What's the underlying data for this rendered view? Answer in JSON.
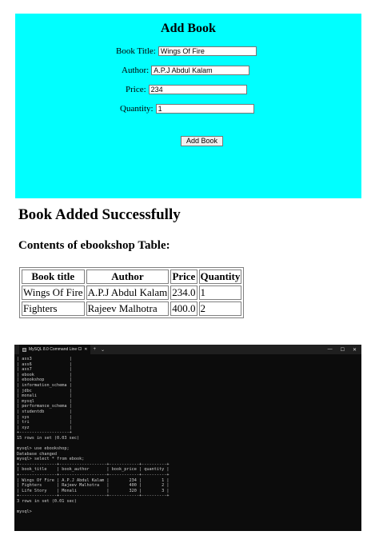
{
  "form": {
    "heading": "Add Book",
    "title_label": "Book Title:",
    "title_value": "Wings Of Fire",
    "author_label": "Author:",
    "author_value": "A.P.J Abdul Kalam",
    "price_label": "Price:",
    "price_value": "234",
    "quantity_label": "Quantity:",
    "quantity_value": "1",
    "submit_label": "Add Book",
    "background": "#00ffff"
  },
  "result": {
    "message": "Book Added Successfully",
    "table_heading": "Contents of ebookshop Table:",
    "columns": [
      "Book title",
      "Author",
      "Price",
      "Quantity"
    ],
    "rows": [
      [
        "Wings Of Fire",
        "A.P.J Abdul Kalam",
        "234.0",
        "1"
      ],
      [
        "Fighters",
        "Rajeev Malhotra",
        "400.0",
        "2"
      ]
    ]
  },
  "terminal": {
    "tab_title": "MySQL 8.0 Command Line Cl",
    "new_tab": "+",
    "dropdown": "⌄",
    "minimize": "—",
    "maximize": "☐",
    "close": "✕",
    "lines": [
      "| ass3               |",
      "| ass6               |",
      "| ass7               |",
      "| ebook              |",
      "| ebookshop          |",
      "| information_schema |",
      "| jdbc               |",
      "| monali             |",
      "| mysql              |",
      "| performance_schema |",
      "| studentdb          |",
      "| sys                |",
      "| tri                |",
      "| xyz                |",
      "+--------------------+",
      "15 rows in set (0.03 sec)",
      "",
      "mysql> use ebookshop;",
      "Database changed",
      "mysql> select * from ebook;",
      "+---------------+-------------------+------------+----------+",
      "| book_title    | book_author       | book_price | quantity |",
      "+---------------+-------------------+------------+----------+",
      "| Wings Of Fire | A.P.J Abdul Kalam |        234 |        1 |",
      "| Fighters      | Rajeev Malhotra   |        400 |        2 |",
      "| Life Story    | Monali            |        320 |        3 |",
      "+---------------+-------------------+------------+----------+",
      "3 rows in set (0.01 sec)",
      "",
      "mysql>"
    ]
  }
}
